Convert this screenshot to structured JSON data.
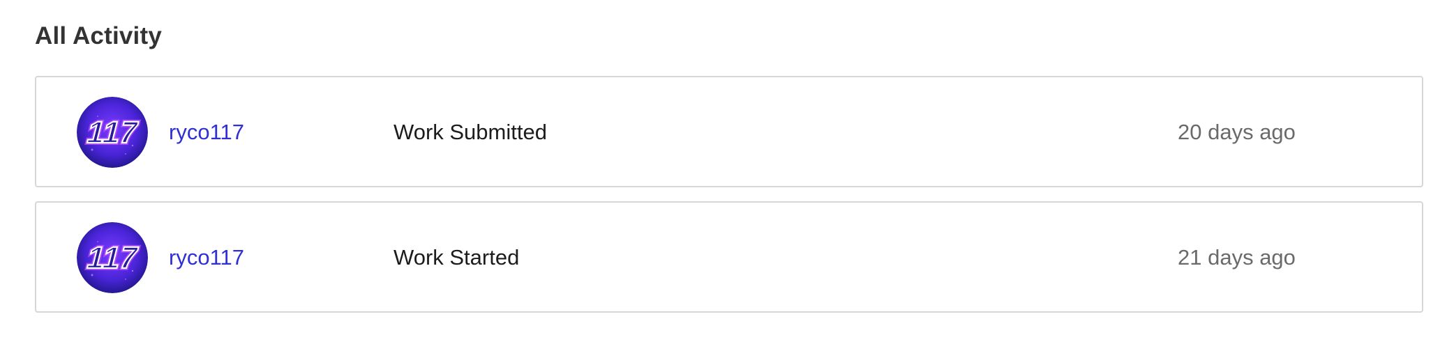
{
  "section": {
    "title": "All Activity"
  },
  "activities": [
    {
      "username": "ryco117",
      "avatar_text": "117",
      "action": "Work Submitted",
      "time": "20 days ago"
    },
    {
      "username": "ryco117",
      "avatar_text": "117",
      "action": "Work Started",
      "time": "21 days ago"
    }
  ],
  "colors": {
    "link": "#2f2fd3",
    "avatar_bg_dark": "#1a1580",
    "avatar_bg_light": "#6a2cf0",
    "avatar_glow": "#d84cff",
    "border": "#d7d7d7",
    "muted_text": "#6a6a6a"
  },
  "icons": {
    "avatar": "user-avatar-117-neon"
  }
}
